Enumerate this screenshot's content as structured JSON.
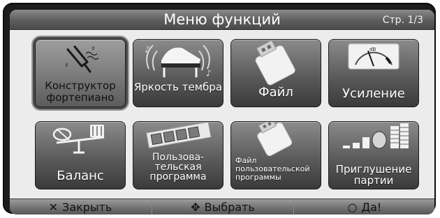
{
  "header": {
    "title": "Меню функций",
    "page": "Стр. 1/3"
  },
  "tiles": [
    {
      "label": "Конструктор фортепиано",
      "icon": "tuning-fork-icon",
      "selected": true
    },
    {
      "label": "Яркость тембра",
      "icon": "piano-icon"
    },
    {
      "label": "Файл",
      "icon": "usb-drive-icon"
    },
    {
      "label": "Усиление",
      "icon": "db-meter-icon"
    },
    {
      "label": "Баланс",
      "icon": "balance-icon"
    },
    {
      "label": "Пользова- тельская программа",
      "icon": "program-slots-icon"
    },
    {
      "label": "Файл пользовательской программы",
      "icon": "usb-drive-icon"
    },
    {
      "label": "Приглушение партии",
      "icon": "part-mute-icon"
    }
  ],
  "footer": {
    "close": {
      "glyph": "✕",
      "label": "Закрыть"
    },
    "select": {
      "glyph": "✥",
      "label": "Выбрать"
    },
    "ok": {
      "glyph": "○",
      "label": "Да!"
    }
  },
  "meter": {
    "unit": "dB"
  }
}
